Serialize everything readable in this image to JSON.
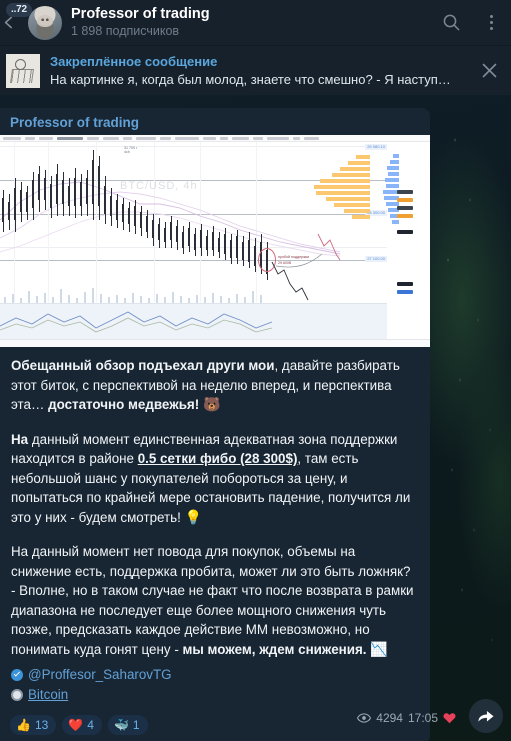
{
  "header": {
    "back_icon": "back-arrow-icon",
    "unread_badge": "..72",
    "avatar": "professor-avatar",
    "title": "Professor of trading",
    "subtitle": "1 898 подписчиков",
    "search_icon": "search-icon",
    "menu_icon": "more-vertical-icon"
  },
  "pinned": {
    "thumb": "pinned-thumbnail",
    "title": "Закреплённое сообщение",
    "text": "На картинке я, когда был молод, знаете что смешно? - Я наступ…",
    "close_icon": "close-icon"
  },
  "message": {
    "author": "Professor of trading",
    "photo": {
      "name": "tradingview-btc-chart",
      "watermark": "BTC/USD, 4h"
    },
    "paragraph1": {
      "bold_lead": "Обещанный обзор подъехал други мои",
      "mid": ", давайте разбирать этот биток, с перспективой на неделю вперед, и перспектива эта…",
      "bold_tail": " достаточно медвежья!",
      "emoji": "🐻"
    },
    "paragraph2": {
      "bold_lead": "На",
      "mid1": " данный момент единственная адекватная зона поддержки находится в районе ",
      "bold_underline": "0.5 сетки фибо (28 300$)",
      "mid2": ", там есть небольшой шанс у покупателей побороться за цену, и попытаться по крайней мере остановить падение, получится ли это у них - будем смотреть!",
      "emoji": "💡"
    },
    "paragraph3": {
      "text": "На данный момент нет повода для покупок, объемы на снижение есть, поддержка пробита, может ли это быть ложняк? - Вполне, но в таком случае не факт что после возврата в рамки диапазона не последует еще более мощного снижения чуть позже, предсказать каждое действие ММ невозможно, но понимать куда гонят цену - ",
      "bold_tail": "мы можем, ждем снижения.",
      "emoji": "📉"
    },
    "links": [
      {
        "icon": "verified-check-icon",
        "label": "@Proffesor_SaharovTG",
        "underline": false
      },
      {
        "icon": "record-circle-icon",
        "label": "Bitcoin",
        "underline": true
      }
    ],
    "reactions": [
      {
        "emoji": "👍",
        "count": "13"
      },
      {
        "emoji": "❤️",
        "count": "4"
      },
      {
        "emoji": "🐳",
        "count": "1"
      }
    ],
    "meta": {
      "views_icon": "eye-icon",
      "views": "4294",
      "time": "17:05",
      "heart_icon": "heart-reaction-icon"
    },
    "share_icon": "share-forward-icon"
  },
  "colors": {
    "header_bg": "#17212b",
    "bubble_bg": "#182633",
    "accent_blue": "#62a0d6",
    "link_blue": "#5aa6dd",
    "reaction_bg": "#1b3047",
    "reaction_text": "#6bb2e8",
    "text_primary": "#f1f4f7",
    "text_muted": "#9aa7b4"
  }
}
